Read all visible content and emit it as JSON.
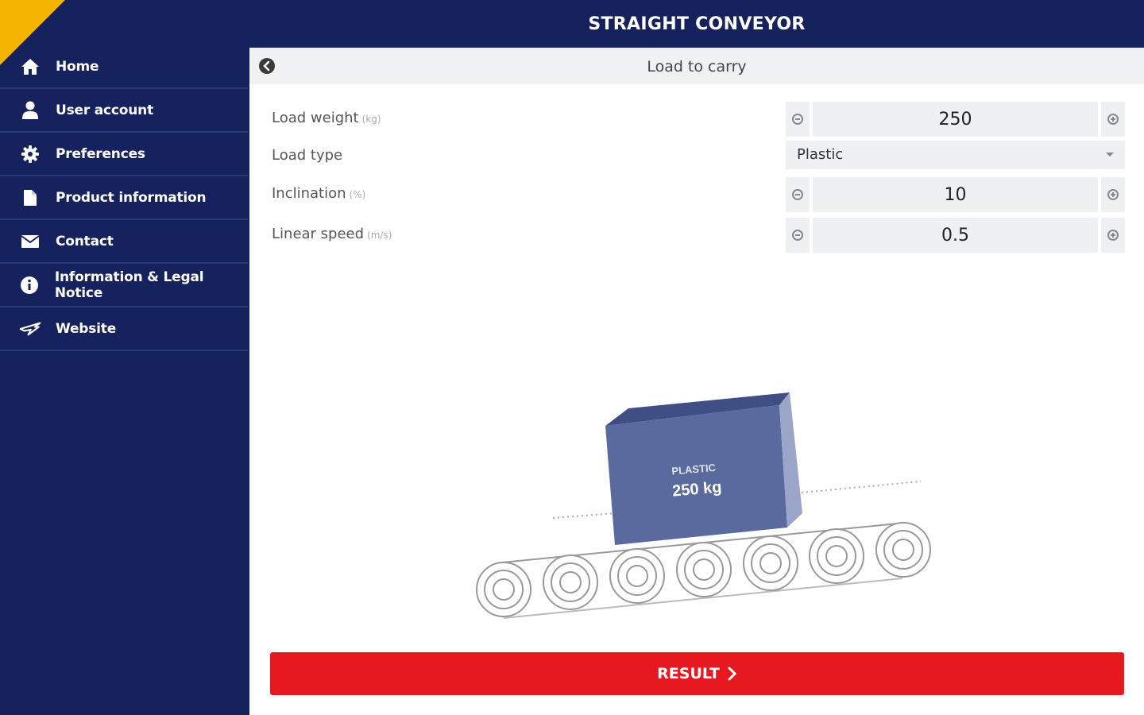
{
  "header": {
    "title": "STRAIGHT CONVEYOR"
  },
  "sidebar": {
    "items": [
      {
        "label": "Home",
        "icon": "home-icon"
      },
      {
        "label": "User account",
        "icon": "user-icon"
      },
      {
        "label": "Preferences",
        "icon": "gear-icon"
      },
      {
        "label": "Product information",
        "icon": "document-icon"
      },
      {
        "label": "Contact",
        "icon": "envelope-icon"
      },
      {
        "label": "Information & Legal Notice",
        "icon": "info-icon"
      },
      {
        "label": "Website",
        "icon": "brand-logo-icon"
      }
    ]
  },
  "panel": {
    "title": "Load to carry",
    "fields": {
      "load_weight": {
        "label": "Load weight",
        "unit": "(kg)",
        "value": "250"
      },
      "load_type": {
        "label": "Load type",
        "value": "Plastic"
      },
      "inclination": {
        "label": "Inclination",
        "unit": "(%)",
        "value": "10"
      },
      "linear_speed": {
        "label": "Linear speed",
        "unit": "(m/s)",
        "value": "0.5"
      }
    },
    "illustration": {
      "material": "PLASTIC",
      "weight": "250 kg"
    },
    "result_label": "RESULT"
  },
  "colors": {
    "navy": "#16225d",
    "accent_yellow": "#f5b400",
    "result_red": "#e5191f",
    "box_fill": "#5a6a9e"
  }
}
